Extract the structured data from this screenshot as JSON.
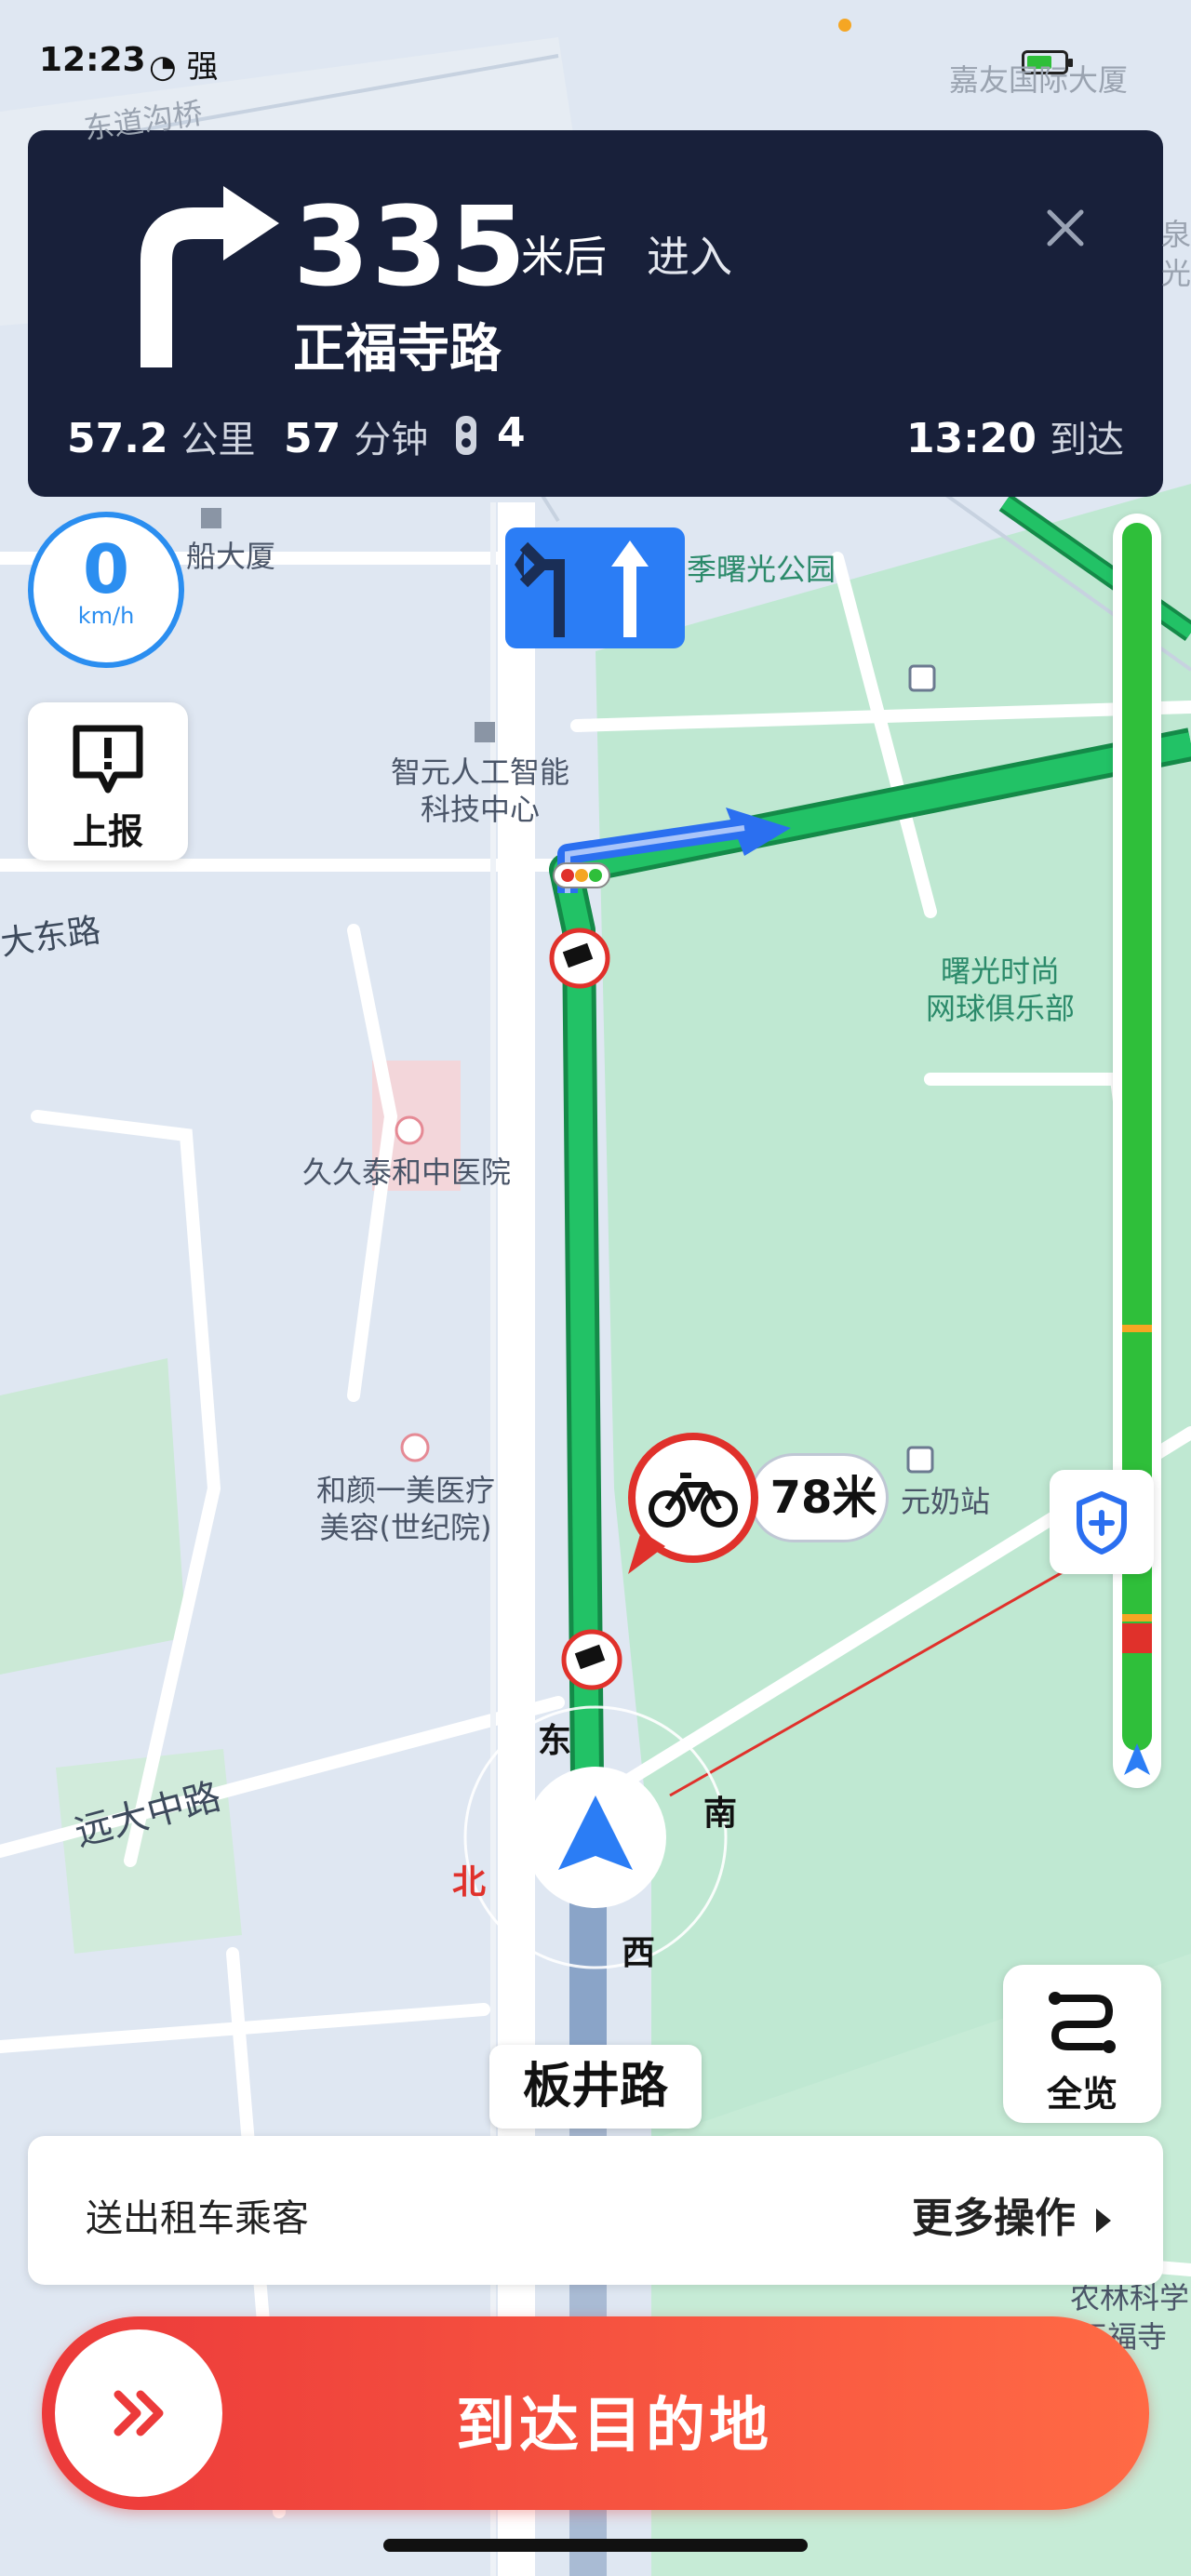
{
  "status_bar": {
    "time": "12:23",
    "signal_text": "强"
  },
  "navigation": {
    "distance": "335",
    "distance_unit": "米后",
    "action": "进入",
    "next_road": "正福寺路",
    "remaining_distance": "57.2",
    "remaining_distance_unit": "公里",
    "remaining_time": "57",
    "remaining_time_unit": "分钟",
    "traffic_lights": "4",
    "arrival_time": "13:20",
    "arrival_label": "到达"
  },
  "speed": {
    "value": "0",
    "unit": "km/h"
  },
  "report_button": {
    "label": "上报"
  },
  "overview_button": {
    "label": "全览"
  },
  "map": {
    "labels": {
      "top_right_building": "嘉友国际大厦",
      "top_left_road": "东道沟桥",
      "building_ship": "船大厦",
      "park": "季曙光公园",
      "ai_center_line1": "智元人工智能",
      "ai_center_line2": "科技中心",
      "east_road": "大东路",
      "tennis_line1": "曙光时尚",
      "tennis_line2": "网球俱乐部",
      "hospital1": "久久泰和中医院",
      "hospital2_line1": "和颜一美医疗",
      "hospital2_line2": "美容(世纪院)",
      "milk_station": "元奶站",
      "main_road": "远大中路",
      "right_edge_top1": "泉",
      "right_edge_top2": "光",
      "right_edge_bottom1": "农林科学",
      "right_edge_bottom2": "正福寺"
    },
    "compass": {
      "east": "东",
      "south": "南",
      "west": "西",
      "north": "北"
    },
    "bike_distance": "78米",
    "current_road": "板井路"
  },
  "action_bar": {
    "left_label": "送出租车乘客",
    "right_label": "更多操作"
  },
  "arrive_button": {
    "label": "到达目的地"
  },
  "colors": {
    "route_green": "#22c266",
    "route_blue": "#2b6ff0",
    "nav_card_bg": "#18203a",
    "arrive_red": "#ec3a3a",
    "accent_blue": "#2b8ef0"
  }
}
